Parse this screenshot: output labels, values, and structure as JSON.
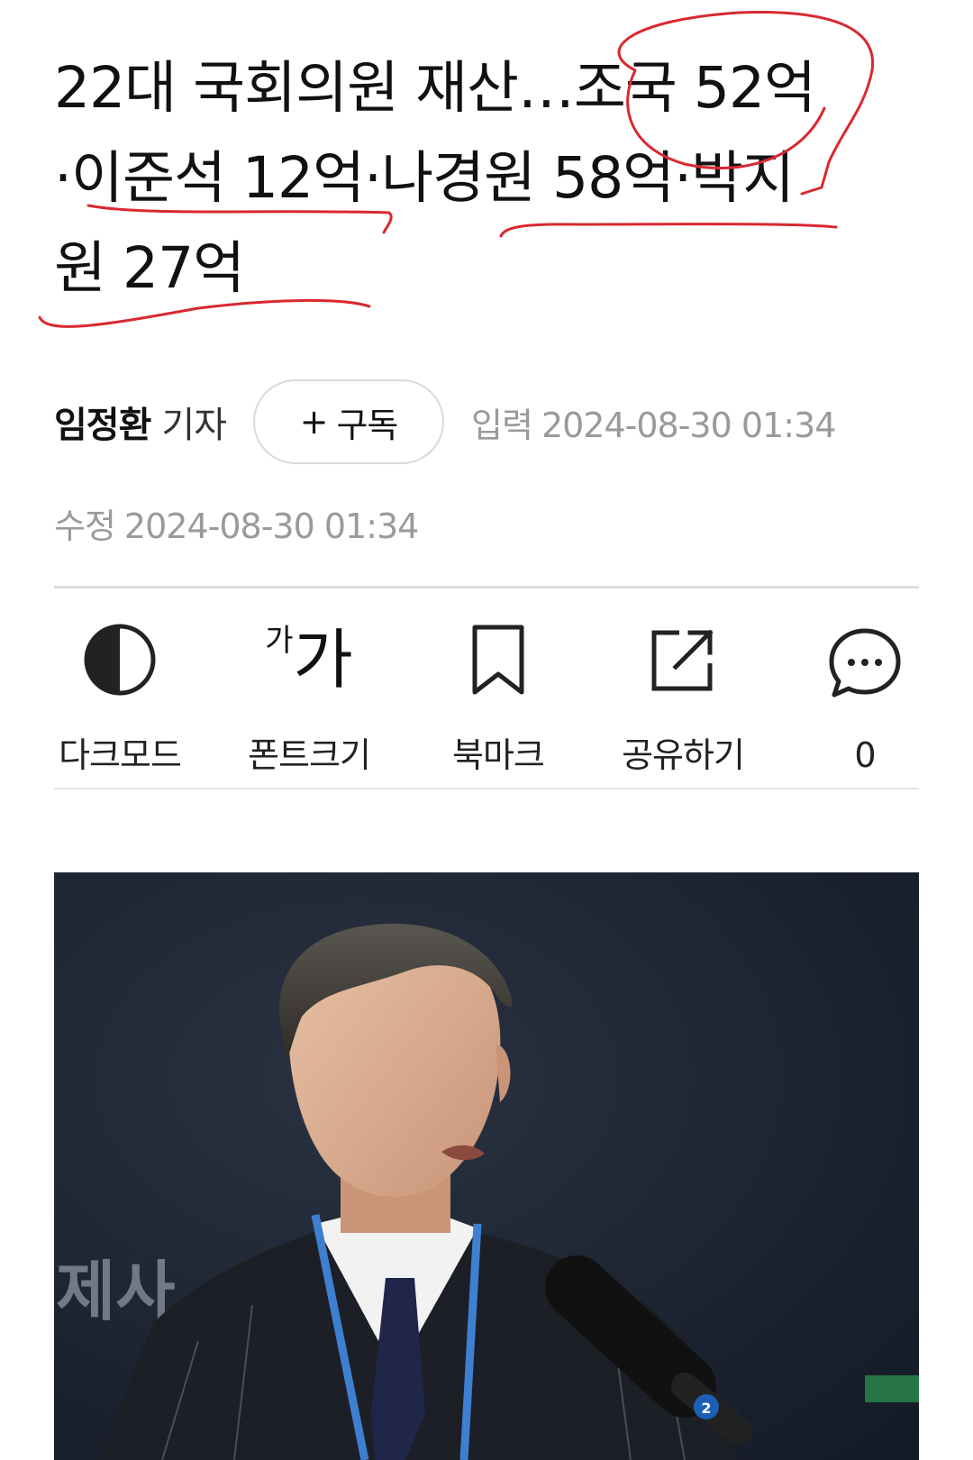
{
  "article": {
    "headline_line1": "22대 국회의원 재산…조국 52억",
    "headline_line2": "·이준석 12억·나경원 58억·박지",
    "headline_line3": "원 27억"
  },
  "byline": {
    "reporter_name": "임정환",
    "reporter_role": "기자",
    "subscribe_plus": "+",
    "subscribe_label": "구독",
    "input_label": "입력",
    "input_datetime": "2024-08-30 01:34",
    "modified_label": "수정",
    "modified_datetime": "2024-08-30 01:34"
  },
  "toolbar": {
    "dark_mode": {
      "label": "다크모드",
      "icon": "half-circle-icon"
    },
    "font_size": {
      "label": "폰트크기",
      "icon_small": "가",
      "icon_big": "가"
    },
    "bookmark": {
      "label": "북마크",
      "icon": "bookmark-icon"
    },
    "share": {
      "label": "공유하기",
      "icon": "share-icon"
    },
    "comments": {
      "count": "0",
      "icon": "speech-bubble-icon"
    }
  },
  "photo": {
    "background_text": "제사",
    "badge_text": "2"
  },
  "colors": {
    "annotation_red": "#d9282f",
    "meta_gray": "#9a9a9a",
    "divider": "#dddddd",
    "lanyard_blue": "#3e7fd0"
  }
}
